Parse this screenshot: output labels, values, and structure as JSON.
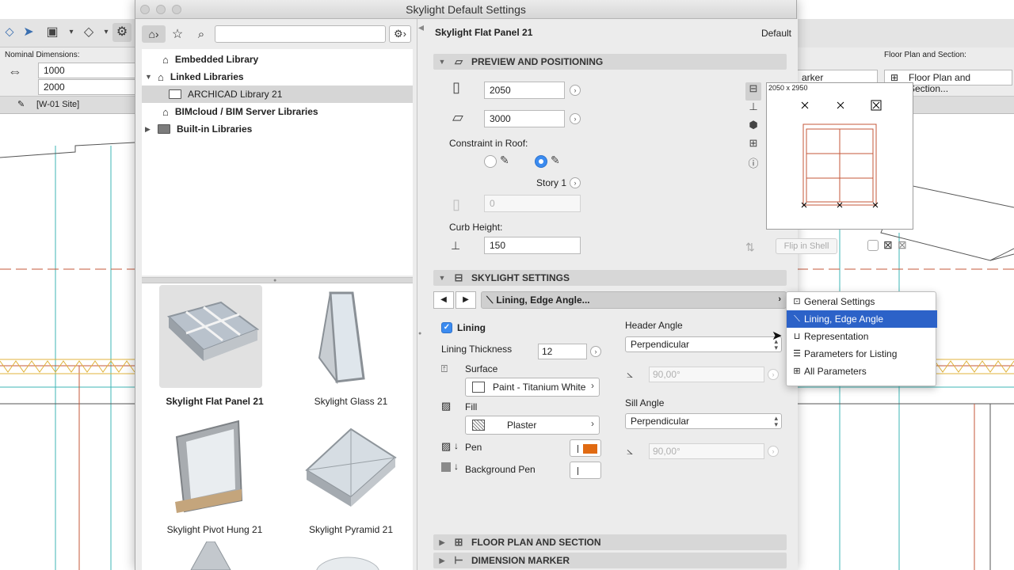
{
  "background": {
    "infobox": {
      "nominal_dimensions_label": "Nominal Dimensions:",
      "width_value": "1000",
      "height_value": "2000",
      "marker_value": "arker",
      "floor_plan_section_label": "Floor Plan and Section:",
      "floor_plan_section_value": "Floor Plan and Section..."
    },
    "tab_label": "[W-01 Site]"
  },
  "dialog": {
    "title": "Skylight Default Settings",
    "left_pane": {
      "search": {
        "value": "",
        "placeholder": ""
      },
      "tree": [
        {
          "label": "Embedded Library",
          "bold": true
        },
        {
          "label": "Linked Libraries",
          "bold": true,
          "expanded": true
        },
        {
          "label": "ARCHICAD Library 21",
          "bold": false,
          "selected": true
        },
        {
          "label": "BIMcloud / BIM Server Libraries",
          "bold": true
        },
        {
          "label": "Built-in Libraries",
          "bold": true,
          "collapsed": true
        }
      ],
      "items": [
        {
          "caption": "Skylight Flat Panel 21",
          "selected": true
        },
        {
          "caption": "Skylight Glass 21"
        },
        {
          "caption": "Skylight Pivot Hung 21"
        },
        {
          "caption": "Skylight Pyramid 21"
        }
      ]
    },
    "right_pane": {
      "object_name": "Skylight Flat Panel 21",
      "default_label": "Default",
      "sections": {
        "preview": "PREVIEW AND POSITIONING",
        "settings": "SKYLIGHT SETTINGS",
        "floor_plan": "FLOOR PLAN AND SECTION",
        "dimension": "DIMENSION MARKER"
      },
      "preview": {
        "height_value": "2050",
        "width_value": "3000",
        "constraint_label": "Constraint in Roof:",
        "story_label": "Story 1",
        "offset_value": "0",
        "curb_height_label": "Curb Height:",
        "curb_height_value": "150",
        "preview_size": "2050 x 2950",
        "flip_in_shell": "Flip in Shell"
      },
      "settings": {
        "current_page": "Lining, Edge Angle...",
        "lining_label": "Lining",
        "lining_thickness_label": "Lining Thickness",
        "lining_thickness_value": "12",
        "surface_label": "Surface",
        "surface_value": "Paint - Titanium White",
        "fill_label": "Fill",
        "fill_value": "Plaster",
        "pen_label": "Pen",
        "background_pen_label": "Background Pen",
        "header_angle_label": "Header Angle",
        "header_angle_value": "Perpendicular",
        "header_angle_deg": "90,00°",
        "sill_angle_label": "Sill Angle",
        "sill_angle_value": "Perpendicular",
        "sill_angle_deg": "90,00°",
        "pen_color": "#e06a12"
      }
    }
  },
  "popup_menu": {
    "items": [
      {
        "label": "General Settings",
        "icon": "general-settings-icon"
      },
      {
        "label": "Lining, Edge Angle",
        "icon": "lining-icon",
        "selected": true
      },
      {
        "label": "Representation",
        "icon": "representation-icon"
      },
      {
        "label": "Parameters for Listing",
        "icon": "listing-icon"
      },
      {
        "label": "All Parameters",
        "icon": "all-parameters-icon"
      }
    ]
  }
}
